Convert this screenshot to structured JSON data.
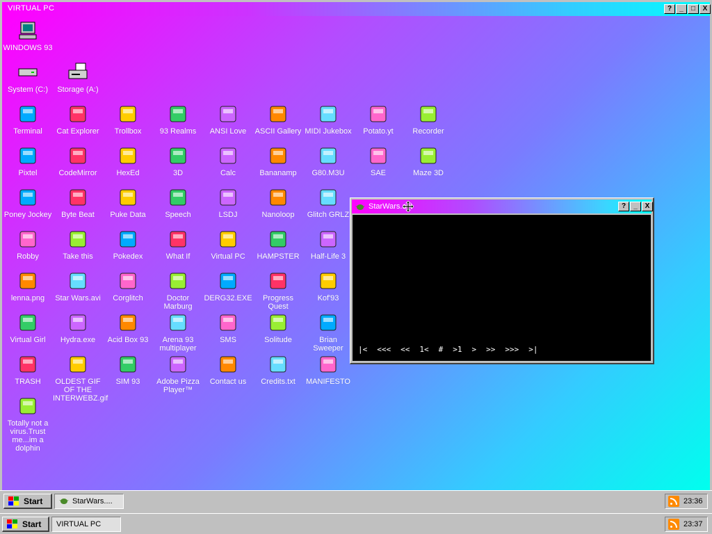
{
  "outer_window": {
    "title": "VIRTUAL PC",
    "buttons": {
      "help": "?",
      "minimize": "_",
      "maximize": "□",
      "close": "X"
    }
  },
  "desktop_icons": [
    {
      "label": "WINDOWS 93",
      "icon": "computer-icon"
    },
    {
      "label": "System (C:)",
      "icon": "drive-icon"
    },
    {
      "label": "Storage (A:)",
      "icon": "floppy-drive-icon"
    },
    {
      "label": "Terminal",
      "icon": "terminal-icon"
    },
    {
      "label": "Cat Explorer",
      "icon": "globe-cat-icon"
    },
    {
      "label": "Trollbox",
      "icon": "chat-smiley-icon"
    },
    {
      "label": "93 Realms",
      "icon": "red-mage-icon"
    },
    {
      "label": "ANSI Love",
      "icon": "letter-a-icon"
    },
    {
      "label": "ASCII Gallery",
      "icon": "numbers-123-icon"
    },
    {
      "label": "MIDI Jukebox",
      "icon": "piano-keys-icon"
    },
    {
      "label": "Potato.yt",
      "icon": "potato-icon"
    },
    {
      "label": "Recorder",
      "icon": "microphone-icon"
    },
    {
      "label": "Pixtel",
      "icon": "palette-icon"
    },
    {
      "label": "CodeMirror",
      "icon": "cat-mirror-icon"
    },
    {
      "label": "HexEd",
      "icon": "cube-icon"
    },
    {
      "label": "3D",
      "icon": "teapot-icon"
    },
    {
      "label": "Calc",
      "icon": "calculator-icon"
    },
    {
      "label": "Bananamp",
      "icon": "banana-icon"
    },
    {
      "label": "G80.M3U",
      "icon": "audio-file-icon"
    },
    {
      "label": "SAE",
      "icon": "amiga-ball-icon"
    },
    {
      "label": "Maze 3D",
      "icon": "maze-icon"
    },
    {
      "label": "Poney Jockey",
      "icon": "pony-icon"
    },
    {
      "label": "Byte Beat",
      "icon": "bytebeat-icon"
    },
    {
      "label": "Puke Data",
      "icon": "pd-icon"
    },
    {
      "label": "Speech",
      "icon": "face-icon"
    },
    {
      "label": "LSDJ",
      "icon": "lsdj-icon"
    },
    {
      "label": "Nanoloop",
      "icon": "wave-icon"
    },
    {
      "label": "Glitch GRLZ",
      "icon": "lips-icon"
    },
    {
      "label": "Robby",
      "icon": "stick-figure-icon"
    },
    {
      "label": "Take this",
      "icon": "pixel-character-icon"
    },
    {
      "label": "Pokedex",
      "icon": "pokedex-icon"
    },
    {
      "label": "What If",
      "icon": "matrix-icon"
    },
    {
      "label": "Virtual PC",
      "icon": "window-cursor-icon"
    },
    {
      "label": "HAMPSTER",
      "icon": "hamster-icon"
    },
    {
      "label": "Half-Life 3",
      "icon": "lambda-icon"
    },
    {
      "label": "lenna.png",
      "icon": "image-file-icon"
    },
    {
      "label": "Star Wars.avi",
      "icon": "yoda-icon"
    },
    {
      "label": "Corglitch",
      "icon": "corgi-icon"
    },
    {
      "label": "Doctor Marburg",
      "icon": "doctor-icon"
    },
    {
      "label": "DERG32.EXE",
      "icon": "monitor-face-icon"
    },
    {
      "label": "Progress Quest",
      "icon": "crossed-swords-icon"
    },
    {
      "label": "Kof'93",
      "icon": "fighter-icon"
    },
    {
      "label": "Virtual Girl",
      "icon": "girl-icon"
    },
    {
      "label": "Hydra.exe",
      "icon": "hydra-icon"
    },
    {
      "label": "Acid Box 93",
      "icon": "acid-smiley-icon"
    },
    {
      "label": "Arena 93 multiplayer",
      "icon": "arena-cube-icon"
    },
    {
      "label": "SMS",
      "icon": "console-icon"
    },
    {
      "label": "Solitude",
      "icon": "bottle-icon"
    },
    {
      "label": "Brian Sweeper",
      "icon": "mine-icon"
    },
    {
      "label": "TRASH",
      "icon": "recycle-bin-icon"
    },
    {
      "label": "OLDEST GIF OF THE INTERWEBZ.gif",
      "icon": "image-file-icon"
    },
    {
      "label": "SIM 93",
      "icon": "book-icon"
    },
    {
      "label": "Adobe Pizza Player™",
      "icon": "pizza-icon"
    },
    {
      "label": "Contact us",
      "icon": "contact-icon"
    },
    {
      "label": "Credits.txt",
      "icon": "text-file-icon"
    },
    {
      "label": "MANIFESTO",
      "icon": "question-icon"
    },
    {
      "label": "Totally not a virus.Trust me...im a dolphin",
      "icon": "dolphin-icon"
    }
  ],
  "player_window": {
    "title": "StarWars.avi",
    "buttons": {
      "help": "?",
      "minimize": "_",
      "close": "X"
    },
    "controls": [
      "|<",
      "<<<",
      "<<",
      "1<",
      "#",
      ">1",
      ">",
      ">>",
      ">>>",
      ">|"
    ]
  },
  "inner_taskbar": {
    "start": "Start",
    "task": "StarWars....",
    "clock": "23:36"
  },
  "outer_taskbar": {
    "start": "Start",
    "task": "VIRTUAL PC",
    "clock": "23:37"
  },
  "colors": {
    "accent_pink": "#ff00ff",
    "accent_cyan": "#00ffff",
    "chrome": "#c0c0c0"
  }
}
